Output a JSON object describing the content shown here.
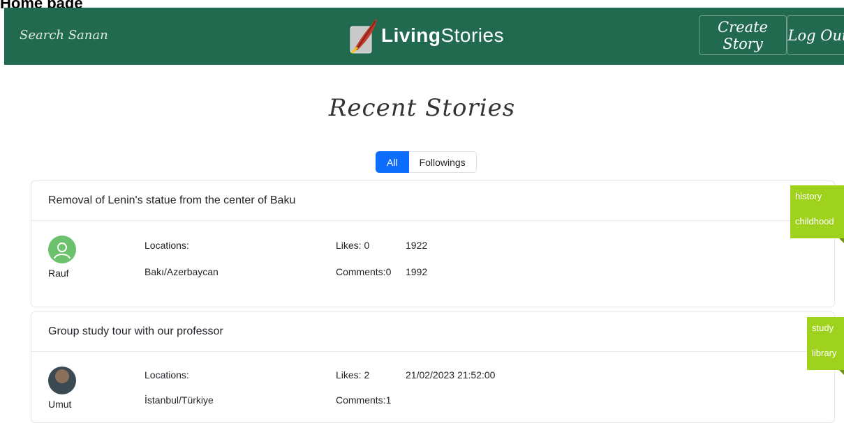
{
  "page_caption": "Home page",
  "navbar": {
    "search_placeholder": "Search Sanan",
    "brand_bold": "Living",
    "brand_rest": "Stories",
    "create_story_label": "Create Story",
    "logout_label": "Log Out",
    "color": "#216a4f"
  },
  "section_title": "Recent Stories",
  "filters": {
    "all_label": "All",
    "followings_label": "Followings",
    "active": "All"
  },
  "stories": [
    {
      "title": "Removal of Lenin's statue from the center of Baku",
      "author": "Rauf",
      "locations_label": "Locations:",
      "location": "Bakı/Azerbaycan",
      "likes_label": "Likes: 0",
      "comments_label": "Comments:0",
      "date_1": "1922",
      "date_2": "1992",
      "tags": [
        "history",
        "childhood"
      ]
    },
    {
      "title": "Group study tour with our professor",
      "author": "Umut",
      "locations_label": "Locations:",
      "location": "İstanbul/Türkiye",
      "likes_label": "Likes: 2",
      "comments_label": "Comments:1",
      "date_1": "21/02/2023 21:52:00",
      "tags": [
        "study",
        "library"
      ]
    }
  ],
  "colors": {
    "tag_bg": "#9fd21d",
    "primary": "#0d6efd"
  }
}
